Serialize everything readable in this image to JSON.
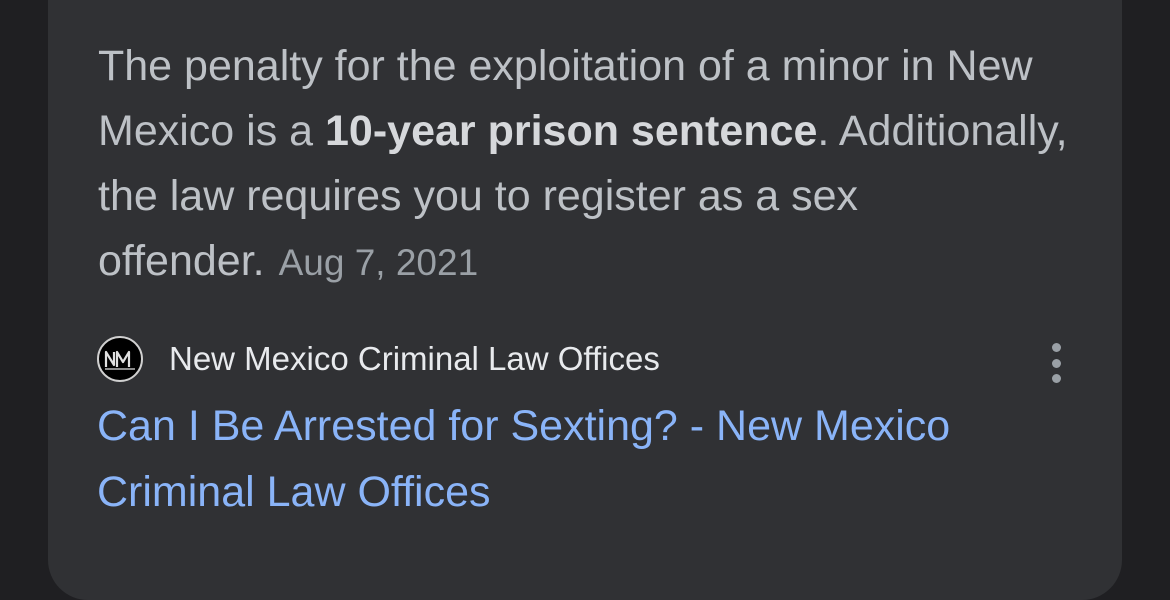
{
  "snippet": {
    "text_before": "The penalty for the exploitation of a minor in New Mexico is a ",
    "bold": "10-year prison sentence",
    "text_after": ". Additionally, the law requires you to register as a sex offender.",
    "date": "Aug 7, 2021"
  },
  "source": {
    "favicon_text": "NM",
    "name": "New Mexico Criminal Law Offices",
    "menu_icon": "more-vert-icon"
  },
  "result": {
    "title": "Can I Be Arrested for Sexting? - New Mexico Criminal Law Offices"
  },
  "colors": {
    "card_bg": "#303134",
    "page_bg": "#1f1f22",
    "snippet_text": "#bdc1c6",
    "link": "#8ab4f8"
  }
}
